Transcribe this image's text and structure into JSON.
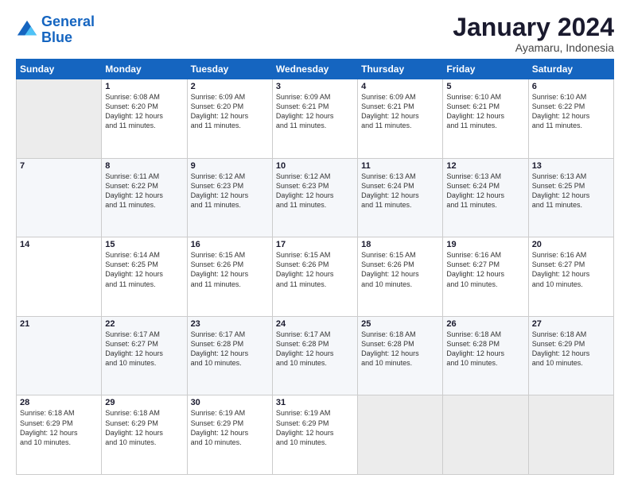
{
  "logo": {
    "line1": "General",
    "line2": "Blue"
  },
  "title": "January 2024",
  "location": "Ayamaru, Indonesia",
  "days_of_week": [
    "Sunday",
    "Monday",
    "Tuesday",
    "Wednesday",
    "Thursday",
    "Friday",
    "Saturday"
  ],
  "weeks": [
    [
      {
        "day": "",
        "info": ""
      },
      {
        "day": "1",
        "info": "Sunrise: 6:08 AM\nSunset: 6:20 PM\nDaylight: 12 hours\nand 11 minutes."
      },
      {
        "day": "2",
        "info": "Sunrise: 6:09 AM\nSunset: 6:20 PM\nDaylight: 12 hours\nand 11 minutes."
      },
      {
        "day": "3",
        "info": "Sunrise: 6:09 AM\nSunset: 6:21 PM\nDaylight: 12 hours\nand 11 minutes."
      },
      {
        "day": "4",
        "info": "Sunrise: 6:09 AM\nSunset: 6:21 PM\nDaylight: 12 hours\nand 11 minutes."
      },
      {
        "day": "5",
        "info": "Sunrise: 6:10 AM\nSunset: 6:21 PM\nDaylight: 12 hours\nand 11 minutes."
      },
      {
        "day": "6",
        "info": "Sunrise: 6:10 AM\nSunset: 6:22 PM\nDaylight: 12 hours\nand 11 minutes."
      }
    ],
    [
      {
        "day": "7",
        "info": ""
      },
      {
        "day": "8",
        "info": "Sunrise: 6:11 AM\nSunset: 6:22 PM\nDaylight: 12 hours\nand 11 minutes."
      },
      {
        "day": "9",
        "info": "Sunrise: 6:12 AM\nSunset: 6:23 PM\nDaylight: 12 hours\nand 11 minutes."
      },
      {
        "day": "10",
        "info": "Sunrise: 6:12 AM\nSunset: 6:23 PM\nDaylight: 12 hours\nand 11 minutes."
      },
      {
        "day": "11",
        "info": "Sunrise: 6:13 AM\nSunset: 6:24 PM\nDaylight: 12 hours\nand 11 minutes."
      },
      {
        "day": "12",
        "info": "Sunrise: 6:13 AM\nSunset: 6:24 PM\nDaylight: 12 hours\nand 11 minutes."
      },
      {
        "day": "13",
        "info": "Sunrise: 6:13 AM\nSunset: 6:25 PM\nDaylight: 12 hours\nand 11 minutes."
      }
    ],
    [
      {
        "day": "14",
        "info": ""
      },
      {
        "day": "15",
        "info": "Sunrise: 6:14 AM\nSunset: 6:25 PM\nDaylight: 12 hours\nand 11 minutes."
      },
      {
        "day": "16",
        "info": "Sunrise: 6:15 AM\nSunset: 6:26 PM\nDaylight: 12 hours\nand 11 minutes."
      },
      {
        "day": "17",
        "info": "Sunrise: 6:15 AM\nSunset: 6:26 PM\nDaylight: 12 hours\nand 11 minutes."
      },
      {
        "day": "18",
        "info": "Sunrise: 6:15 AM\nSunset: 6:26 PM\nDaylight: 12 hours\nand 10 minutes."
      },
      {
        "day": "19",
        "info": "Sunrise: 6:16 AM\nSunset: 6:27 PM\nDaylight: 12 hours\nand 10 minutes."
      },
      {
        "day": "20",
        "info": "Sunrise: 6:16 AM\nSunset: 6:27 PM\nDaylight: 12 hours\nand 10 minutes."
      }
    ],
    [
      {
        "day": "21",
        "info": ""
      },
      {
        "day": "22",
        "info": "Sunrise: 6:17 AM\nSunset: 6:27 PM\nDaylight: 12 hours\nand 10 minutes."
      },
      {
        "day": "23",
        "info": "Sunrise: 6:17 AM\nSunset: 6:28 PM\nDaylight: 12 hours\nand 10 minutes."
      },
      {
        "day": "24",
        "info": "Sunrise: 6:17 AM\nSunset: 6:28 PM\nDaylight: 12 hours\nand 10 minutes."
      },
      {
        "day": "25",
        "info": "Sunrise: 6:18 AM\nSunset: 6:28 PM\nDaylight: 12 hours\nand 10 minutes."
      },
      {
        "day": "26",
        "info": "Sunrise: 6:18 AM\nSunset: 6:28 PM\nDaylight: 12 hours\nand 10 minutes."
      },
      {
        "day": "27",
        "info": "Sunrise: 6:18 AM\nSunset: 6:29 PM\nDaylight: 12 hours\nand 10 minutes."
      }
    ],
    [
      {
        "day": "28",
        "info": "Sunrise: 6:18 AM\nSunset: 6:29 PM\nDaylight: 12 hours\nand 10 minutes."
      },
      {
        "day": "29",
        "info": "Sunrise: 6:18 AM\nSunset: 6:29 PM\nDaylight: 12 hours\nand 10 minutes."
      },
      {
        "day": "30",
        "info": "Sunrise: 6:19 AM\nSunset: 6:29 PM\nDaylight: 12 hours\nand 10 minutes."
      },
      {
        "day": "31",
        "info": "Sunrise: 6:19 AM\nSunset: 6:29 PM\nDaylight: 12 hours\nand 10 minutes."
      },
      {
        "day": "",
        "info": ""
      },
      {
        "day": "",
        "info": ""
      },
      {
        "day": "",
        "info": ""
      }
    ]
  ]
}
